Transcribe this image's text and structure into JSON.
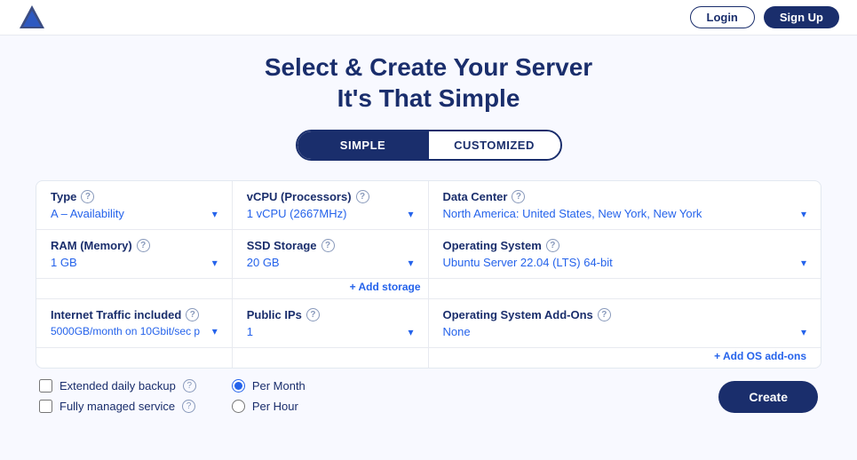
{
  "topbar": {
    "btn_login": "Login",
    "btn_signup": "Sign Up"
  },
  "header": {
    "line1": "Select & Create Your Server",
    "line2": "It's That Simple"
  },
  "toggle": {
    "simple": "SIMPLE",
    "customized": "CUSTOMIZED"
  },
  "fields": {
    "type": {
      "label": "Type",
      "value": "A – Availability"
    },
    "vcpu": {
      "label": "vCPU (Processors)",
      "value": "1 vCPU (2667MHz)"
    },
    "datacenter": {
      "label": "Data Center",
      "value": "North America: United States, New York, New York"
    },
    "ram": {
      "label": "RAM (Memory)",
      "value": "1 GB"
    },
    "ssd": {
      "label": "SSD Storage",
      "value": "20 GB"
    },
    "os": {
      "label": "Operating System",
      "value": "Ubuntu Server 22.04 (LTS) 64-bit"
    },
    "traffic": {
      "label": "Internet Traffic included",
      "value": "5000GB/month on 10Gbit/sec p"
    },
    "public_ips": {
      "label": "Public IPs",
      "value": "1"
    },
    "os_addons": {
      "label": "Operating System Add-Ons",
      "value": "None"
    }
  },
  "links": {
    "add_storage": "+ Add storage",
    "add_os_addons": "+ Add OS add-ons"
  },
  "extras": {
    "checkbox1": "Extended daily backup",
    "checkbox2": "Fully managed service",
    "radio1": "Per Month",
    "radio2": "Per Hour"
  },
  "buttons": {
    "create": "Create"
  }
}
